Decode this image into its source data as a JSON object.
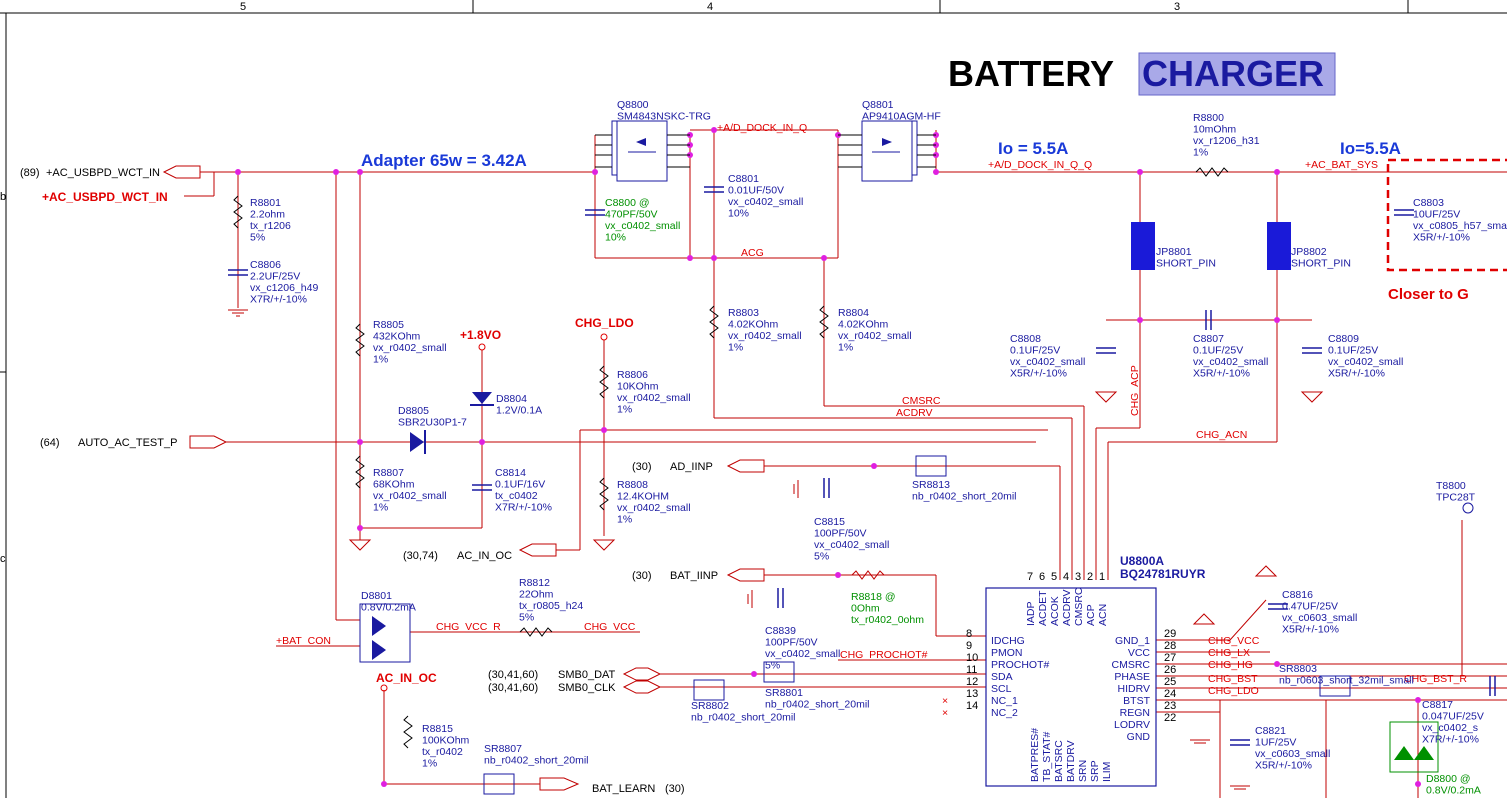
{
  "frame": {
    "cols": [
      "5",
      "4",
      "3"
    ],
    "side_markers": [
      "b",
      "c"
    ]
  },
  "title": {
    "main": "BATTERY",
    "highlight": "CHARGER"
  },
  "headings": {
    "adapter": "Adapter 65w = 3.42A",
    "io1": "Io = 5.5A",
    "io2": "Io=5.5A",
    "closer": "Closer to G",
    "chg_ldo": "CHG_LDO",
    "v18": "+1.8VO",
    "ac_in_oc": "AC_IN_OC"
  },
  "ports": [
    {
      "ref": "(89)",
      "name": "+AC_USBPD_WCT_IN"
    },
    {
      "ref": "(64)",
      "name": "AUTO_AC_TEST_P"
    },
    {
      "ref": "(30)",
      "name": "AD_IINP"
    },
    {
      "ref": "(30,74)",
      "name": "AC_IN_OC"
    },
    {
      "ref": "(30)",
      "name": "BAT_IINP"
    },
    {
      "ref": "(30,41,60)",
      "name": "SMB0_DAT"
    },
    {
      "ref": "(30,41,60)",
      "name": "SMB0_CLK"
    },
    {
      "ref": "(30)",
      "name": "BAT_LEARN"
    }
  ],
  "nets": {
    "ac_in_red": "+AC_USBPD_WCT_IN",
    "dock_q": "+A/D_DOCK_IN_Q",
    "dock_qq": "+A/D_DOCK_IN_Q_Q",
    "bat_sys": "+AC_BAT_SYS",
    "acg": "ACG",
    "cmsrc": "CMSRC",
    "acdrv": "ACDRV",
    "chg_acp": "CHG_ACP",
    "chg_acn": "CHG_ACN",
    "bat_con": "+BAT_CON",
    "chg_vcc_r": "CHG_VCC_R",
    "chg_vcc": "CHG_VCC",
    "chg_prochot": "CHG_PROCHOT#",
    "chg_vcc2": "CHG_VCC",
    "chg_lx": "CHG_LX",
    "chg_hg": "CHG_HG",
    "chg_bst": "CHG_BST",
    "chg_ldo2": "CHG_LDO",
    "chg_bst_r": "CHG_BST_R"
  },
  "parts": {
    "q8800": [
      "Q8800",
      "SM4843NSKC-TRG"
    ],
    "q8801": [
      "Q8801",
      "AP9410AGM-HF"
    ],
    "r8801": [
      "R8801",
      "2.2ohm",
      "tx_r1206",
      "5%"
    ],
    "c8806": [
      "C8806",
      "2.2UF/25V",
      "vx_c1206_h49",
      "X7R/+/-10%"
    ],
    "c8800": [
      "C8800 @",
      "470PF/50V",
      "vx_c0402_small",
      "10%"
    ],
    "c8801": [
      "C8801",
      "0.01UF/50V",
      "vx_c0402_small",
      "10%"
    ],
    "r8800": [
      "R8800",
      "10mOhm",
      "vx_r1206_h31",
      "1%"
    ],
    "c8803": [
      "C8803",
      "10UF/25V",
      "vx_c0805_h57_small",
      "X5R/+/-10%"
    ],
    "jp8801": [
      "JP8801",
      "SHORT_PIN"
    ],
    "jp8802": [
      "JP8802",
      "SHORT_PIN"
    ],
    "r8805": [
      "R8805",
      "432KOhm",
      "vx_r0402_small",
      "1%"
    ],
    "d8804": [
      "D8804",
      "1.2V/0.1A"
    ],
    "r8806": [
      "R8806",
      "10KOhm",
      "vx_r0402_small",
      "1%"
    ],
    "r8803": [
      "R8803",
      "4.02KOhm",
      "vx_r0402_small",
      "1%"
    ],
    "r8804": [
      "R8804",
      "4.02KOhm",
      "vx_r0402_small",
      "1%"
    ],
    "c8808": [
      "C8808",
      "0.1UF/25V",
      "vx_c0402_small",
      "X5R/+/-10%"
    ],
    "c8807": [
      "C8807",
      "0.1UF/25V",
      "vx_c0402_small",
      "X5R/+/-10%"
    ],
    "c8809": [
      "C8809",
      "0.1UF/25V",
      "vx_c0402_small",
      "X5R/+/-10%"
    ],
    "d8805": [
      "D8805",
      "SBR2U30P1-7"
    ],
    "r8807": [
      "R8807",
      "68KOhm",
      "vx_r0402_small",
      "1%"
    ],
    "c8814": [
      "C8814",
      "0.1UF/16V",
      "tx_c0402",
      "X7R/+/-10%"
    ],
    "r8808": [
      "R8808",
      "12.4KOHM",
      "vx_r0402_small",
      "1%"
    ],
    "sr8813": [
      "SR8813",
      "nb_r0402_short_20mil"
    ],
    "c8815": [
      "C8815",
      "100PF/50V",
      "vx_c0402_small",
      "5%"
    ],
    "d8801": [
      "D8801",
      "0.8V/0.2mA"
    ],
    "r8812": [
      "R8812",
      "22Ohm",
      "tx_r0805_h24",
      "5%"
    ],
    "r8818": [
      "R8818 @",
      "0Ohm",
      "tx_r0402_0ohm"
    ],
    "c8839": [
      "C8839",
      "100PF/50V",
      "vx_c0402_small",
      "5%"
    ],
    "sr8801": [
      "SR8801",
      "nb_r0402_short_20mil"
    ],
    "sr8802": [
      "SR8802",
      "nb_r0402_short_20mil"
    ],
    "r8815": [
      "R8815",
      "100KOhm",
      "tx_r0402",
      "1%"
    ],
    "sr8807": [
      "SR8807",
      "nb_r0402_short_20mil"
    ],
    "c8816": [
      "C8816",
      "0.47UF/25V",
      "vx_c0603_small",
      "X5R/+/-10%"
    ],
    "sr8803": [
      "SR8803",
      "nb_r0603_short_32mil_small"
    ],
    "c8821": [
      "C8821",
      "1UF/25V",
      "vx_c0603_small",
      "X5R/+/-10%"
    ],
    "c8817": [
      "C8817",
      "0.047UF/25V",
      "vx_c0402_s",
      "X7R/+/-10%"
    ],
    "d8800": [
      "D8800 @",
      "0.8V/0.2mA"
    ],
    "t8800": [
      "T8800",
      "TPC28T"
    ]
  },
  "ic": {
    "ref": "U8800A",
    "part": "BQ24781RUYR",
    "top_pins": [
      "IADP",
      "ACDET",
      "ACOK",
      "ACDRV",
      "CMSRC",
      "ACP",
      "ACN"
    ],
    "top_nums": [
      "7",
      "6",
      "5",
      "4",
      "3",
      "2",
      "1"
    ],
    "left_pins": [
      [
        "8",
        "IDCHG"
      ],
      [
        "9",
        "PMON"
      ],
      [
        "10",
        "PROCHOT#"
      ],
      [
        "11",
        "SDA"
      ],
      [
        "12",
        "SCL"
      ],
      [
        "13",
        "NC_1"
      ],
      [
        "14",
        "NC_2"
      ]
    ],
    "right_pins": [
      [
        "29",
        "GND_1"
      ],
      [
        "28",
        "VCC"
      ],
      [
        "27",
        "CMSRC"
      ],
      [
        "26",
        "PHASE"
      ],
      [
        "25",
        "HIDRV"
      ],
      [
        "24",
        "BTST"
      ],
      [
        "23",
        "REGN"
      ],
      [
        "22",
        "LODRV"
      ],
      [
        "",
        "GND"
      ]
    ],
    "bottom_pins": [
      "BATPRES#",
      "TB_STAT#",
      "BATSRC",
      "BATDRV",
      "SRN",
      "SRP",
      "ILIM"
    ]
  }
}
